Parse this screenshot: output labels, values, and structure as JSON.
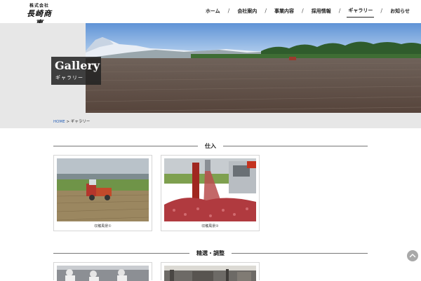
{
  "header": {
    "logo_sub": "株式会社",
    "logo_main": "長崎商事",
    "nav": [
      "ホーム",
      "会社案内",
      "事業内容",
      "採用情報",
      "ギャラリー",
      "お知らせ"
    ],
    "nav_separator": "/",
    "active_nav": "ギャラリー"
  },
  "hero": {
    "title_en": "Gallery",
    "title_jp": "ギャラリー"
  },
  "breadcrumb": {
    "home": "HOME",
    "separator": ">",
    "current": "ギャラリー"
  },
  "sections": [
    {
      "title": "仕入",
      "cards": [
        {
          "caption": "収穫風景①"
        },
        {
          "caption": "収穫風景②"
        }
      ]
    },
    {
      "title": "精選・調整"
    }
  ],
  "icons": {
    "scroll_top": "chevron-up-icon"
  },
  "colors": {
    "breadcrumb_link": "#2a62b8",
    "hero_box": "#222222",
    "hero_band": "#e7e7e7"
  }
}
